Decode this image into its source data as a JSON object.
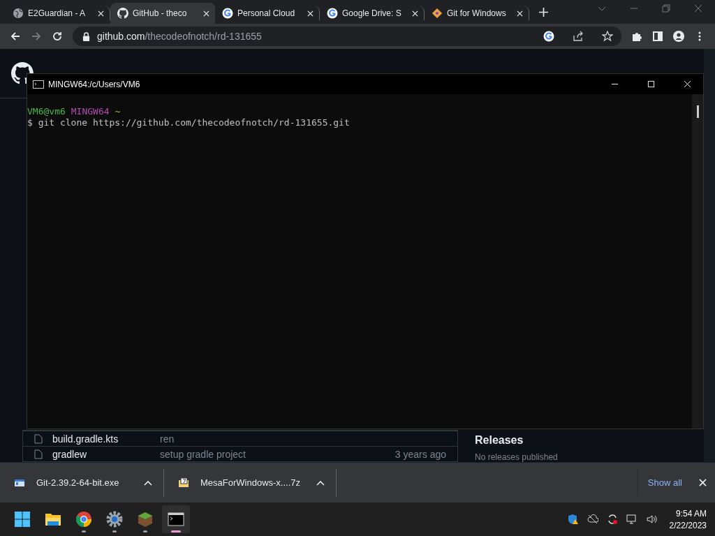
{
  "browser": {
    "tabs": [
      {
        "title": "E2Guardian - A",
        "kind": "globe",
        "selected": false
      },
      {
        "title": "GitHub - theco",
        "kind": "github",
        "selected": true
      },
      {
        "title": "Personal Cloud",
        "kind": "google",
        "selected": false
      },
      {
        "title": "Google Drive: S",
        "kind": "google",
        "selected": false
      },
      {
        "title": "Git for Windows",
        "kind": "git",
        "selected": false
      }
    ],
    "address": {
      "host": "github.com",
      "path": "/thecodeofnotch/rd-131655"
    }
  },
  "page": {
    "files": [
      {
        "name": "build.gradle.kts",
        "message": "ren"
      },
      {
        "name": "gradlew",
        "message": "setup gradle project",
        "time": "3 years ago"
      }
    ],
    "releases": {
      "heading": "Releases",
      "note": "No releases published"
    }
  },
  "terminal": {
    "title": "MINGW64:/c/Users/VM6",
    "user": "VM6@vm6",
    "env": "MINGW64",
    "dir": "~",
    "command": "$ git clone https://github.com/thecodeofnotch/rd-131655.git"
  },
  "downloads": {
    "items": [
      {
        "name": "Git-2.39.2-64-bit.exe",
        "kind": "exe"
      },
      {
        "name": "MesaForWindows-x....7z",
        "kind": "archive"
      }
    ],
    "show_all": "Show all"
  },
  "taskbar": {
    "apps": [
      {
        "kind": "start",
        "running": false,
        "selected": false
      },
      {
        "kind": "explorer",
        "running": false,
        "selected": false
      },
      {
        "kind": "chrome",
        "running": true,
        "selected": false
      },
      {
        "kind": "settings",
        "running": true,
        "selected": false
      },
      {
        "kind": "minecraft",
        "running": true,
        "selected": false
      },
      {
        "kind": "terminal",
        "running": true,
        "selected": true
      }
    ],
    "time": "9:54 AM",
    "date": "2/22/2023"
  }
}
